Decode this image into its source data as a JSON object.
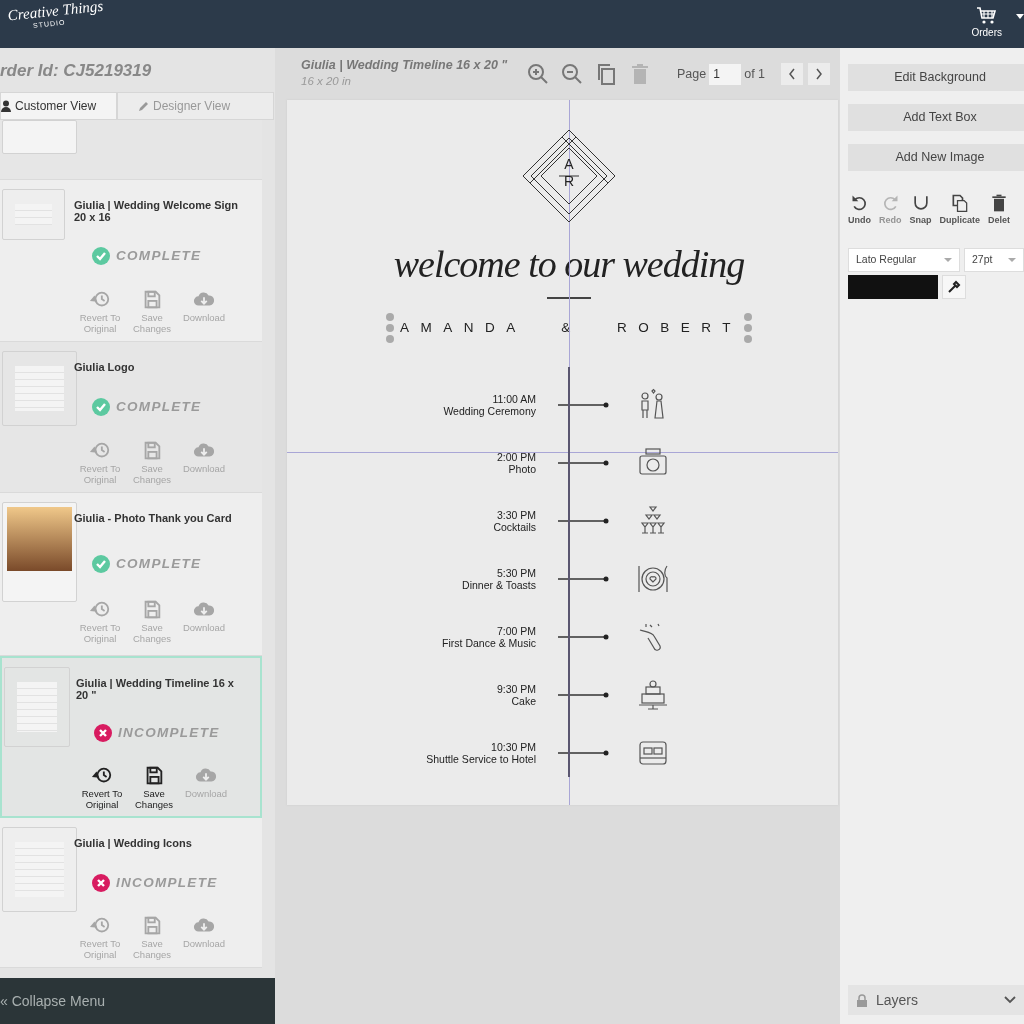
{
  "brand": {
    "name": "Creative Things",
    "tagline": "STUDIO"
  },
  "nav": {
    "orders": "Orders"
  },
  "order": {
    "label": "rder Id: CJ5219319"
  },
  "view_tabs": [
    {
      "label": "Customer View",
      "selected": true
    },
    {
      "label": "Designer View",
      "selected": false
    }
  ],
  "designs": [
    {
      "title": "Giulia | Wedding Welcome Sign 20 x 16",
      "complete": true,
      "status": "COMPLETE",
      "selected": false,
      "actions": [
        {
          "kind": "revert",
          "label": "Revert To Original",
          "enabled": false
        },
        {
          "kind": "save",
          "label": "Save Changes",
          "enabled": false
        },
        {
          "kind": "download",
          "label": "Download",
          "enabled": false
        }
      ]
    },
    {
      "title": "Giulia Logo",
      "complete": true,
      "status": "COMPLETE",
      "selected": false,
      "actions": [
        {
          "kind": "revert",
          "label": "Revert To Original",
          "enabled": false
        },
        {
          "kind": "save",
          "label": "Save Changes",
          "enabled": false
        },
        {
          "kind": "download",
          "label": "Download",
          "enabled": false
        }
      ]
    },
    {
      "title": "Giulia - Photo Thank you Card",
      "complete": true,
      "status": "COMPLETE",
      "selected": false,
      "actions": [
        {
          "kind": "revert",
          "label": "Revert To Original",
          "enabled": false
        },
        {
          "kind": "save",
          "label": "Save Changes",
          "enabled": false
        },
        {
          "kind": "download",
          "label": "Download",
          "enabled": false
        }
      ]
    },
    {
      "title": "Giulia | Wedding Timeline 16 x 20 \"",
      "complete": false,
      "status": "INCOMPLETE",
      "selected": true,
      "actions": [
        {
          "kind": "revert",
          "label": "Revert To Original",
          "enabled": true
        },
        {
          "kind": "save",
          "label": "Save Changes",
          "enabled": true
        },
        {
          "kind": "download",
          "label": "Download",
          "enabled": false
        }
      ]
    },
    {
      "title": "Giulia | Wedding Icons",
      "complete": false,
      "status": "INCOMPLETE",
      "selected": false,
      "actions": [
        {
          "kind": "revert",
          "label": "Revert To Original",
          "enabled": false
        },
        {
          "kind": "save",
          "label": "Save Changes",
          "enabled": false
        },
        {
          "kind": "download",
          "label": "Download",
          "enabled": false
        }
      ]
    }
  ],
  "collapse_menu": {
    "glyph": "«",
    "label": "Collapse Menu"
  },
  "editor": {
    "title": "Giulia | Wedding Timeline 16 x 20 \"",
    "size": "16 x 20 in",
    "tools": [
      {
        "kind": "zoom-in",
        "enabled": true
      },
      {
        "kind": "zoom-out",
        "enabled": true
      },
      {
        "kind": "copy",
        "enabled": true
      },
      {
        "kind": "delete",
        "enabled": false
      }
    ],
    "page_label": "Page",
    "page": "1",
    "page_of": "of 1"
  },
  "canvas": {
    "monogram_top": "A",
    "monogram_bottom": "R",
    "heading": "welcome to our wedding",
    "names": "AMANDA & ROBERT",
    "events": [
      {
        "time": "11:00 AM",
        "label": "Wedding Ceremony"
      },
      {
        "time": "2:00 PM",
        "label": "Photo"
      },
      {
        "time": "3:30 PM",
        "label": "Cocktails"
      },
      {
        "time": "5:30 PM",
        "label": "Dinner & Toasts"
      },
      {
        "time": "7:00 PM",
        "label": "First Dance & Music"
      },
      {
        "time": "9:30 PM",
        "label": "Cake"
      },
      {
        "time": "10:30 PM",
        "label": "Shuttle Service to Hotel"
      }
    ]
  },
  "side_actions": [
    "Edit Background",
    "Add Text Box",
    "Add New Image"
  ],
  "edit_tools": [
    {
      "kind": "undo",
      "label": "Undo",
      "enabled": true
    },
    {
      "kind": "redo",
      "label": "Redo",
      "enabled": false
    },
    {
      "kind": "snap",
      "label": "Snap",
      "enabled": true
    },
    {
      "kind": "duplicate",
      "label": "Duplicate",
      "enabled": true
    },
    {
      "kind": "delete",
      "label": "Delet",
      "enabled": true
    }
  ],
  "font": {
    "family": "Lato Regular",
    "size": "27pt"
  },
  "layers": {
    "label": "Layers"
  }
}
